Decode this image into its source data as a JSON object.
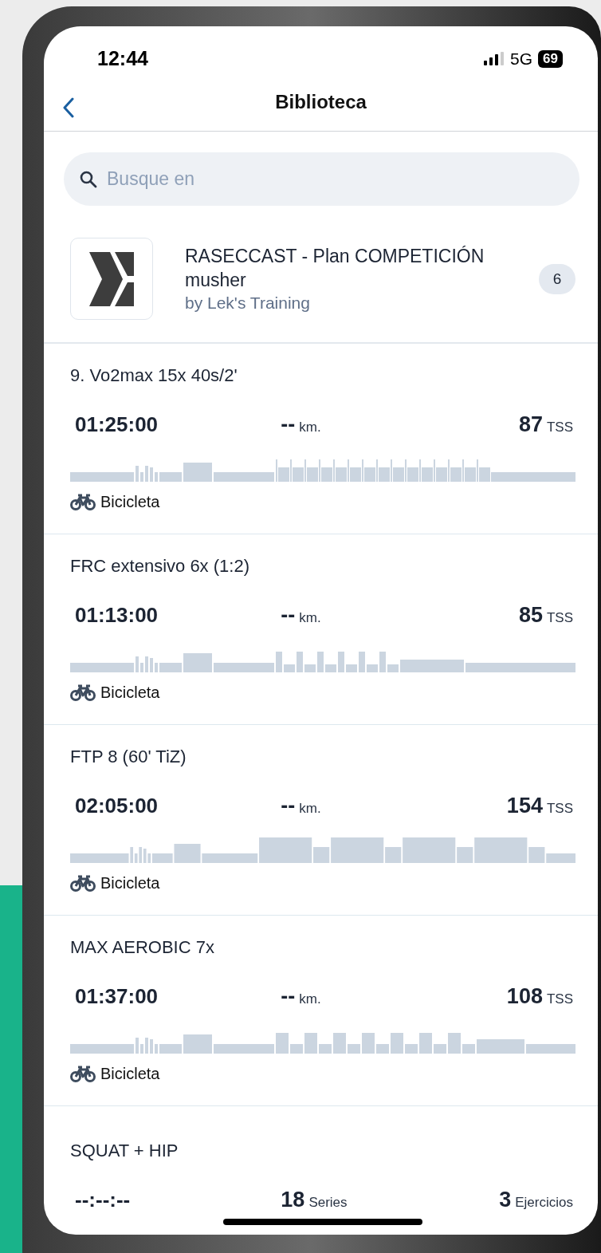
{
  "status_bar": {
    "time": "12:44",
    "network": "5G",
    "battery": "69"
  },
  "nav": {
    "title": "Biblioteca"
  },
  "search": {
    "placeholder": "Busque en"
  },
  "plan": {
    "title": "RASECCAST - Plan COMPETICIÓN musher",
    "author": "by Lek's Training",
    "count": "6"
  },
  "workouts": [
    {
      "kind": "ride",
      "title": "9. Vo2max 15x 40s/2'",
      "duration": "01:25:00",
      "stats": [
        {
          "value": "--",
          "unit": "km."
        },
        {
          "value": "87",
          "unit": "TSS"
        }
      ],
      "sport": "Bicicleta"
    },
    {
      "kind": "ride",
      "title": "FRC extensivo 6x (1:2)",
      "duration": "01:13:00",
      "stats": [
        {
          "value": "--",
          "unit": "km."
        },
        {
          "value": "85",
          "unit": "TSS"
        }
      ],
      "sport": "Bicicleta"
    },
    {
      "kind": "ride",
      "title": "FTP 8 (60' TiZ)",
      "duration": "02:05:00",
      "stats": [
        {
          "value": "--",
          "unit": "km."
        },
        {
          "value": "154",
          "unit": "TSS"
        }
      ],
      "sport": "Bicicleta"
    },
    {
      "kind": "ride",
      "title": "MAX AEROBIC 7x",
      "duration": "01:37:00",
      "stats": [
        {
          "value": "--",
          "unit": "km."
        },
        {
          "value": "108",
          "unit": "TSS"
        }
      ],
      "sport": "Bicicleta"
    },
    {
      "kind": "strength",
      "title": "SQUAT + HIP",
      "duration": "--:--:--",
      "stats": [
        {
          "value": "18",
          "unit": "Series"
        },
        {
          "value": "3",
          "unit": "Ejercicios"
        }
      ]
    }
  ]
}
